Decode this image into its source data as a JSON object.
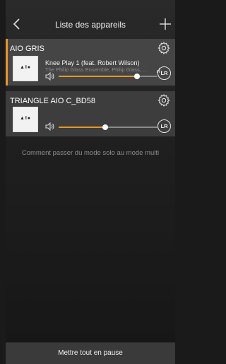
{
  "header": {
    "title": "Liste des appareils",
    "back_icon": "chevron-left-icon",
    "add_icon": "plus-icon"
  },
  "devices": [
    {
      "name": "AIO GRIS",
      "active": true,
      "cover_logo": "▲I●",
      "track_title": "Knee Play 1 (feat. Robert Wilson)",
      "track_artist": "The Philip Glass Ensemble, Philip Glass, ...",
      "volume": 0.79,
      "badge": "LR"
    },
    {
      "name": "TRIANGLE AIO C_BD58",
      "active": false,
      "cover_logo": "▲I●",
      "volume": 0.47,
      "badge": "LR"
    }
  ],
  "help_link": "Comment passer du mode solo au mode multi",
  "footer": {
    "pause_all": "Mettre tout en pause"
  },
  "colors": {
    "accent": "#e8962b",
    "background": "#1f1f1f",
    "card": "#3d3d3d"
  }
}
